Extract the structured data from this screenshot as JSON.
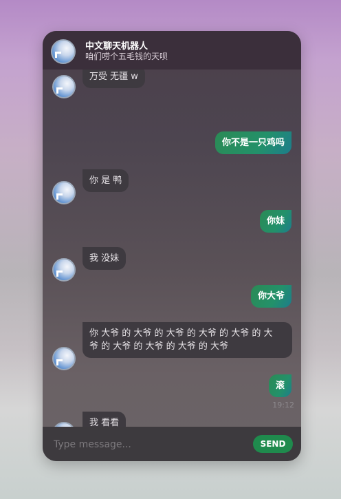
{
  "header": {
    "title": "中文聊天机器人",
    "subtitle": "咱们唠个五毛钱的天呗",
    "avatar_icon": "bot-avatar-icon"
  },
  "messages": [
    {
      "sender": "bot",
      "text": "万受 无疆 w"
    },
    {
      "sender": "user",
      "text": "你不是一只鸡吗"
    },
    {
      "sender": "bot",
      "text": "你 是 鸭"
    },
    {
      "sender": "user",
      "text": "你妹"
    },
    {
      "sender": "bot",
      "text": "我 没妹"
    },
    {
      "sender": "user",
      "text": "你大爷"
    },
    {
      "sender": "bot",
      "text": "你 大爷 的 大爷 的 大爷 的 大爷 的 大爷 的 大",
      "text2": "爷 的 大爷 的 大爷 的 大爷 的 大爷"
    },
    {
      "sender": "user",
      "text": "滚",
      "time": "19:12"
    },
    {
      "sender": "bot",
      "text": "我 看看"
    }
  ],
  "composer": {
    "placeholder": "Type message...",
    "send_label": "SEND"
  },
  "colors": {
    "user_bubble": "#23916a",
    "bot_bubble": "#3e3a40",
    "send_button": "#1f8a4d"
  }
}
